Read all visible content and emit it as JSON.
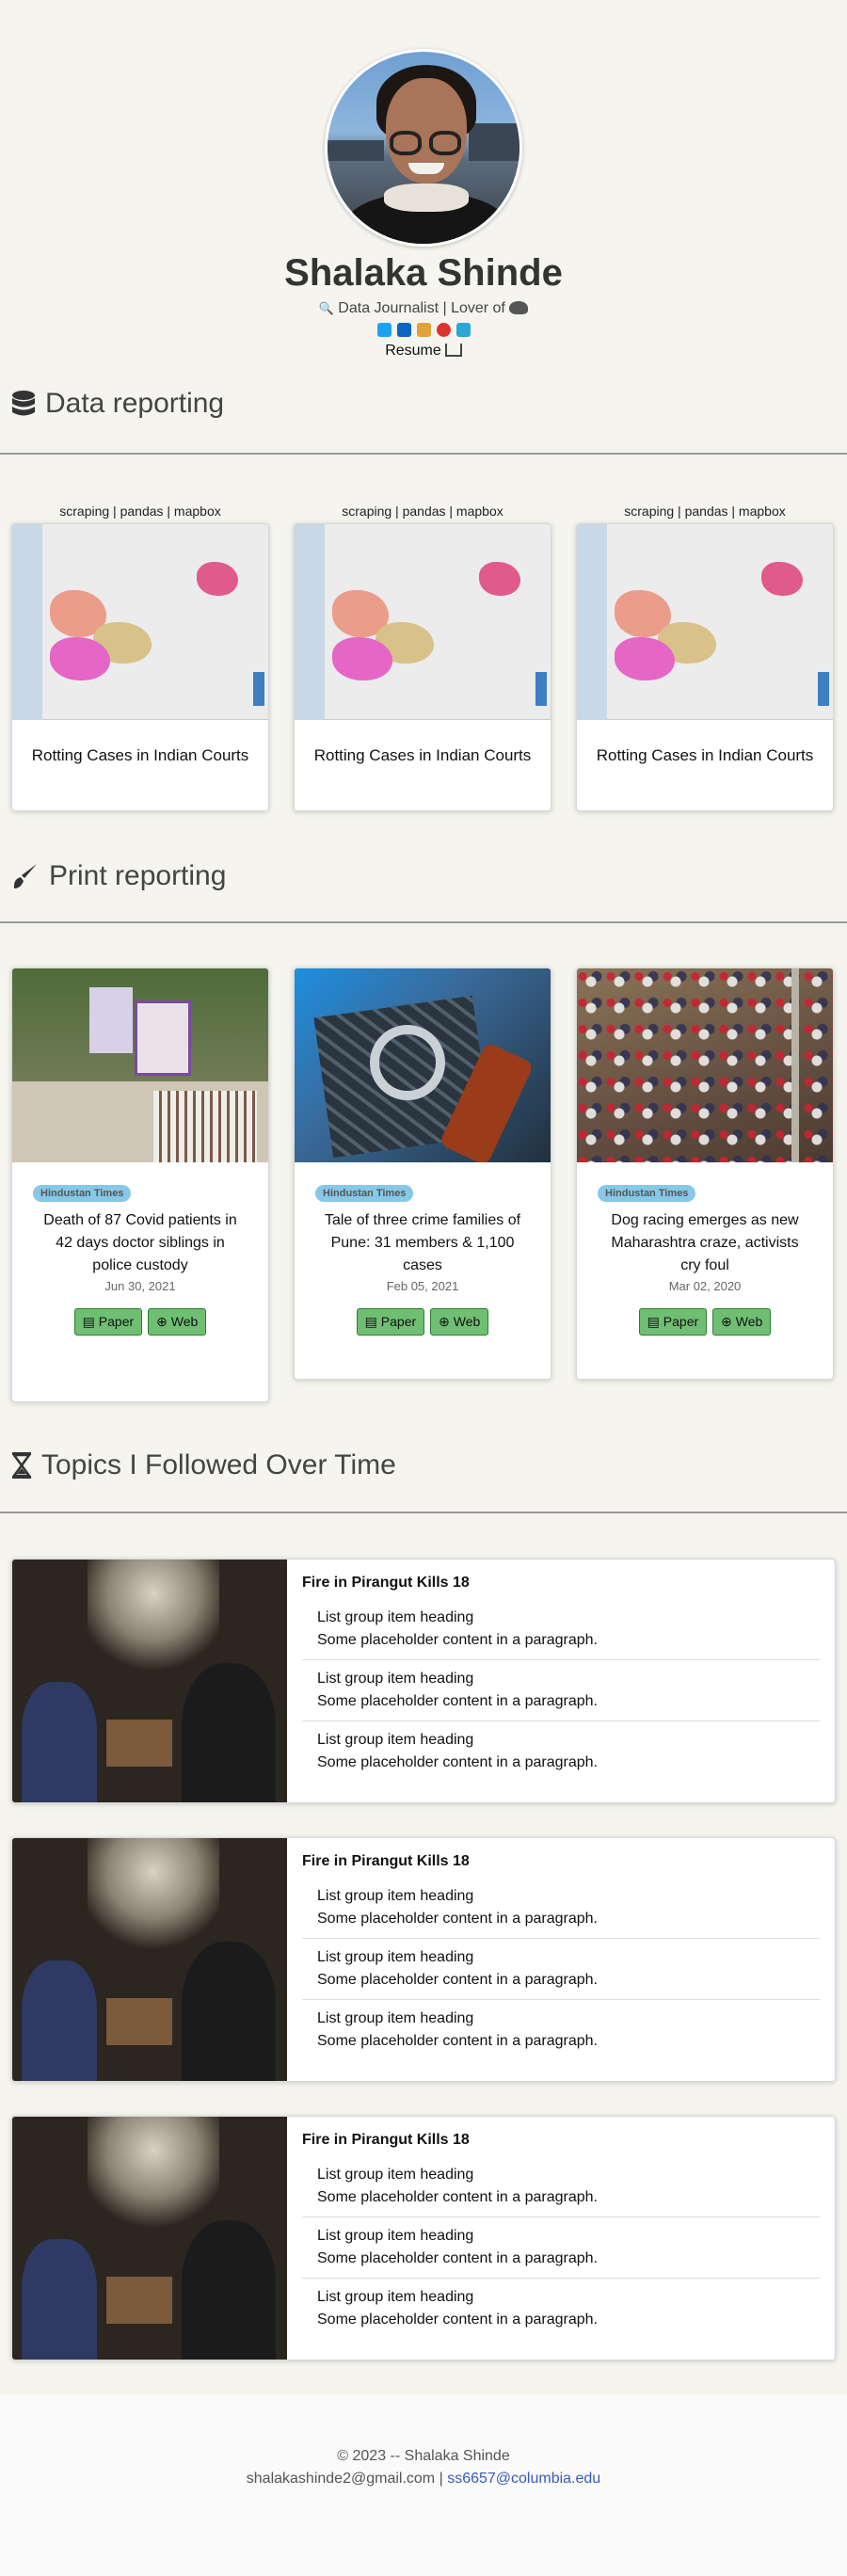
{
  "profile": {
    "name": "Shalaka Shinde",
    "tagline": "Data Journalist | Lover of",
    "resume_label": "Resume"
  },
  "social_icons": [
    "twitter-icon",
    "linkedin-icon",
    "instagram-icon",
    "github-icon",
    "email-icon"
  ],
  "data_reporting": {
    "heading": "Data reporting",
    "cards": [
      {
        "tags": "scraping | pandas | mapbox",
        "title": "Rotting Cases in Indian Courts"
      },
      {
        "tags": "scraping | pandas | mapbox",
        "title": "Rotting Cases in Indian Courts"
      },
      {
        "tags": "scraping | pandas | mapbox",
        "title": "Rotting Cases in Indian Courts"
      }
    ]
  },
  "print_reporting": {
    "heading": "Print reporting",
    "cards": [
      {
        "source": "Hindustan Times",
        "title": "Death of 87 Covid patients in 42 days doctor siblings in police custody",
        "date": "Jun 30, 2021",
        "paper": "Paper",
        "web": "Web"
      },
      {
        "source": "Hindustan Times",
        "title": "Tale of three crime families of Pune: 31 members & 1,100 cases",
        "date": "Feb 05, 2021",
        "paper": "Paper",
        "web": "Web"
      },
      {
        "source": "Hindustan Times",
        "title": "Dog racing emerges as new Maharashtra craze, activists cry foul",
        "date": "Mar 02, 2020",
        "paper": "Paper",
        "web": "Web"
      }
    ]
  },
  "topics": {
    "heading": "Topics I Followed Over Time",
    "cards": [
      {
        "title": "Fire in Pirangut Kills 18",
        "items": [
          {
            "heading": "List group item heading",
            "text": "Some placeholder content in a paragraph."
          },
          {
            "heading": "List group item heading",
            "text": "Some placeholder content in a paragraph."
          },
          {
            "heading": "List group item heading",
            "text": "Some placeholder content in a paragraph."
          }
        ]
      },
      {
        "title": "Fire in Pirangut Kills 18",
        "items": [
          {
            "heading": "List group item heading",
            "text": "Some placeholder content in a paragraph."
          },
          {
            "heading": "List group item heading",
            "text": "Some placeholder content in a paragraph."
          },
          {
            "heading": "List group item heading",
            "text": "Some placeholder content in a paragraph."
          }
        ]
      },
      {
        "title": "Fire in Pirangut Kills 18",
        "items": [
          {
            "heading": "List group item heading",
            "text": "Some placeholder content in a paragraph."
          },
          {
            "heading": "List group item heading",
            "text": "Some placeholder content in a paragraph."
          },
          {
            "heading": "List group item heading",
            "text": "Some placeholder content in a paragraph."
          }
        ]
      }
    ]
  },
  "footer": {
    "copyright": "© 2023 -- Shalaka Shinde",
    "email": "shalakashinde2@gmail.com",
    "separator": "|",
    "link": "ss6657@columbia.edu"
  },
  "colors": {
    "background": "#f5f4ef",
    "badge": "#87c8e8",
    "button": "#6fbf73",
    "link": "#3b5bb5"
  }
}
